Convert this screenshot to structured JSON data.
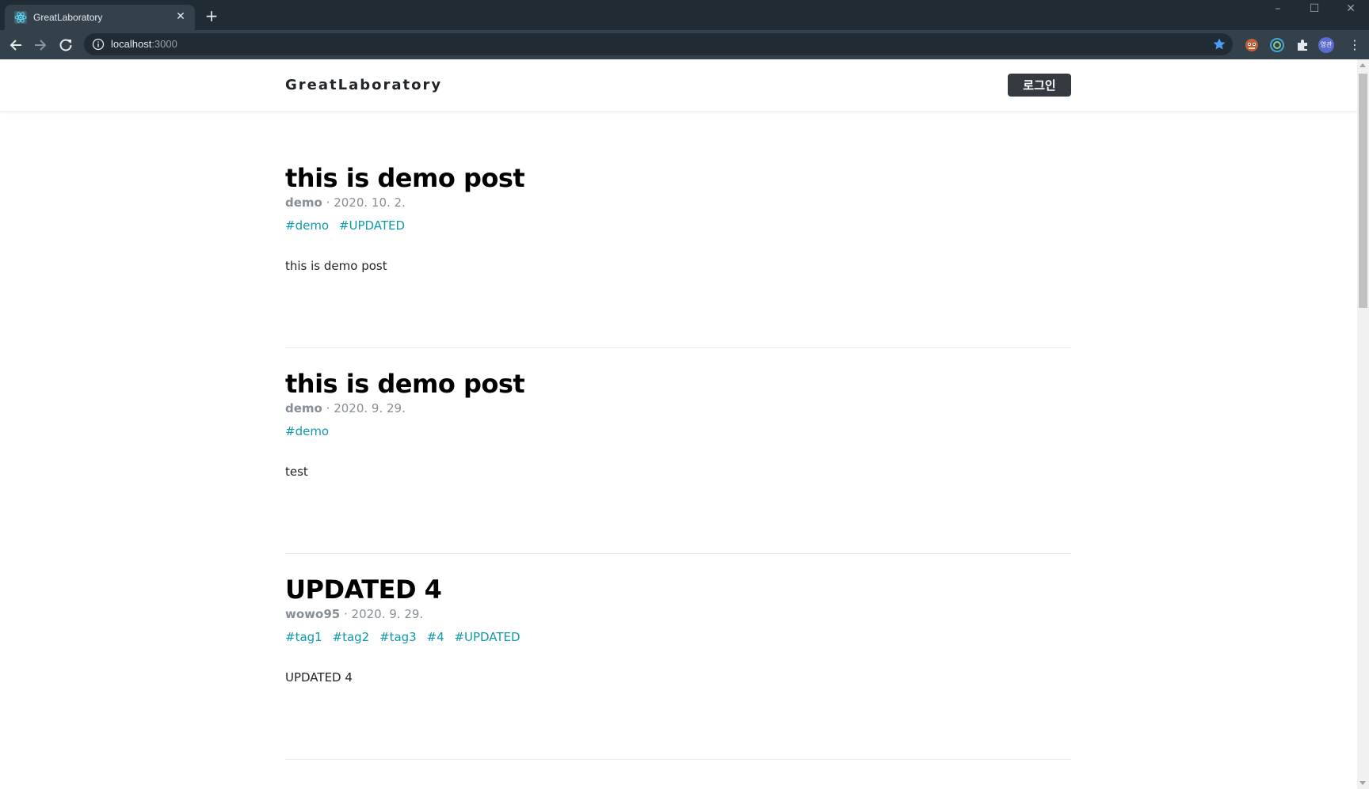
{
  "browser": {
    "tab_title": "GreatLaboratory",
    "url_host": "localhost",
    "url_port": ":3000",
    "profile_initials": "영관"
  },
  "header": {
    "logo": "GreatLaboratory",
    "login_label": "로그인"
  },
  "posts": [
    {
      "title": "this is demo post",
      "author": "demo",
      "date": "2020. 10. 2.",
      "tags": [
        "#demo",
        "#UPDATED"
      ],
      "body": "this is demo post"
    },
    {
      "title": "this is demo post",
      "author": "demo",
      "date": "2020. 9. 29.",
      "tags": [
        "#demo"
      ],
      "body": "test"
    },
    {
      "title": "UPDATED 4",
      "author": "wowo95",
      "date": "2020. 9. 29.",
      "tags": [
        "#tag1",
        "#tag2",
        "#tag3",
        "#4",
        "#UPDATED"
      ],
      "body": "UPDATED 4"
    }
  ],
  "colors": {
    "tag": "#1098ad",
    "meta": "#868e96",
    "login_bg": "#343a40",
    "chrome_dark": "#202b33",
    "chrome_toolbar": "#35414a"
  }
}
